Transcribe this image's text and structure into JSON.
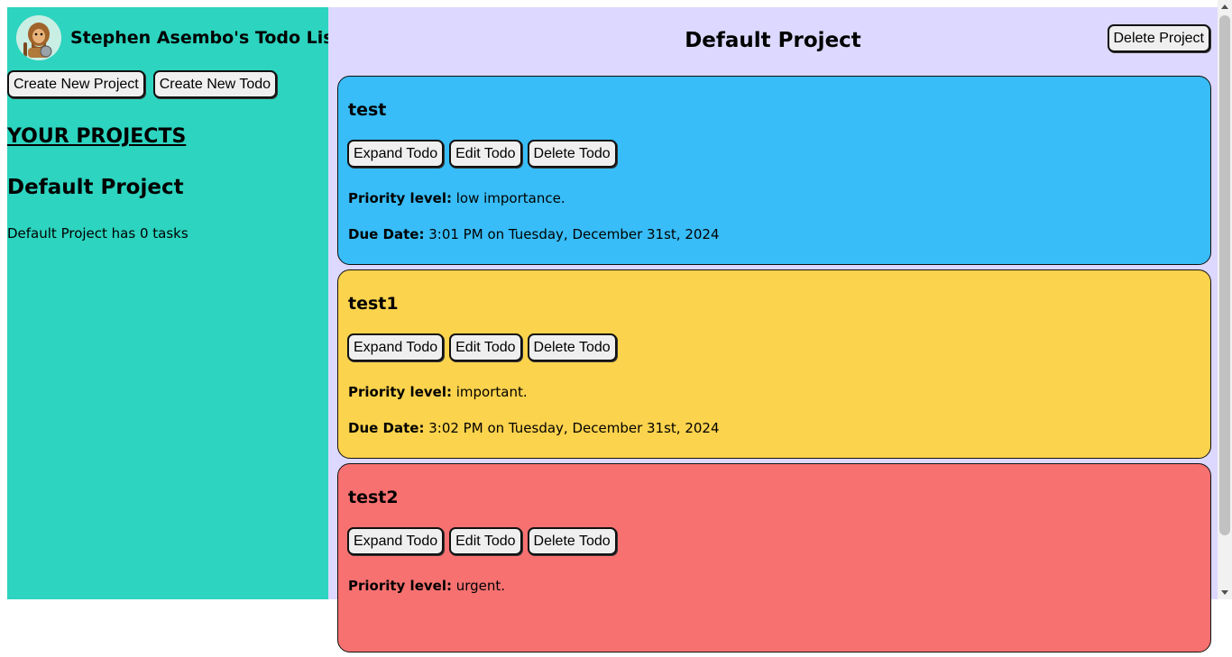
{
  "sidebar": {
    "app_title": "Stephen Asembo's Todo List",
    "create_project_label": "Create New Project",
    "create_todo_label": "Create New Todo",
    "projects_heading": "YOUR PROJECTS",
    "projects": [
      {
        "name": "Default Project",
        "count_text": "Default Project has 0 tasks"
      }
    ]
  },
  "main": {
    "project_title": "Default Project",
    "delete_project_label": "Delete Project",
    "todos": [
      {
        "title": "test",
        "expand_label": "Expand Todo",
        "edit_label": "Edit Todo",
        "delete_label": "Delete Todo",
        "priority_label": "Priority level:",
        "priority_value": "low importance.",
        "due_label": "Due Date:",
        "due_value": "3:01 PM on Tuesday, December 31st, 2024"
      },
      {
        "title": "test1",
        "expand_label": "Expand Todo",
        "edit_label": "Edit Todo",
        "delete_label": "Delete Todo",
        "priority_label": "Priority level:",
        "priority_value": "important.",
        "due_label": "Due Date:",
        "due_value": "3:02 PM on Tuesday, December 31st, 2024"
      },
      {
        "title": "test2",
        "expand_label": "Expand Todo",
        "edit_label": "Edit Todo",
        "delete_label": "Delete Todo",
        "priority_label": "Priority level:",
        "priority_value": "urgent."
      }
    ]
  },
  "colors": {
    "sidebar_bg": "#2dd4bf",
    "main_bg": "#dcd8ff",
    "priority_low": "#38bdf8",
    "priority_important": "#fcd34d",
    "priority_urgent": "#f87171"
  },
  "icons": {
    "avatar": "cartoon-caveman-avatar",
    "scroll_up": "arrow-up-icon",
    "scroll_down": "arrow-down-icon"
  }
}
